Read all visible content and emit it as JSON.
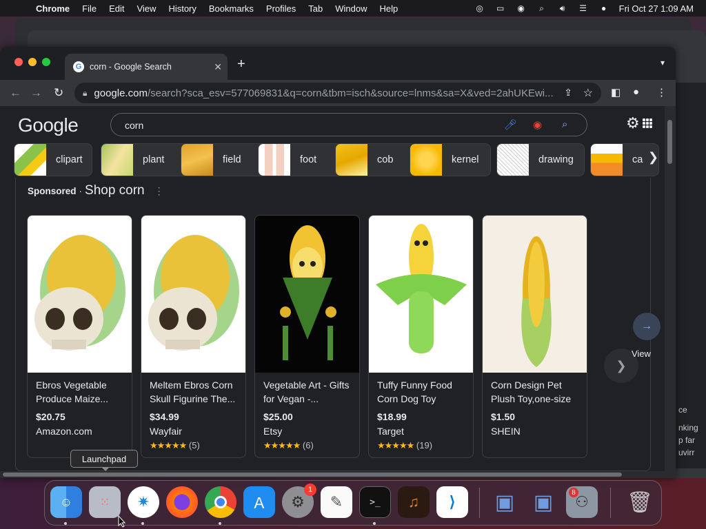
{
  "menubar": {
    "app_name": "Chrome",
    "menus": [
      "File",
      "Edit",
      "View",
      "History",
      "Bookmarks",
      "Profiles",
      "Tab",
      "Window",
      "Help"
    ],
    "datetime": "Fri Oct 27  1:09 AM"
  },
  "tab": {
    "title": "corn - Google Search"
  },
  "address": {
    "host": "google.com",
    "path": "/search?sca_esv=577069831&q=corn&tbm=isch&source=lnms&sa=X&ved=2ahUKEwi..."
  },
  "search": {
    "logo": "Google",
    "query": "corn"
  },
  "chips": [
    {
      "label": "clipart",
      "color": "#8bc34a"
    },
    {
      "label": "plant",
      "color": "#c5d86d"
    },
    {
      "label": "field",
      "color": "#e0a32a"
    },
    {
      "label": "foot",
      "color": "#f3d0c0"
    },
    {
      "label": "cob",
      "color": "#f0c419"
    },
    {
      "label": "kernel",
      "color": "#f6b800"
    },
    {
      "label": "drawing",
      "color": "#e6e6e6"
    },
    {
      "label": "ca",
      "color": "#f28c28"
    }
  ],
  "sponsored": {
    "label": "Sponsored",
    "separator": "·",
    "heading": "Shop corn"
  },
  "products": [
    {
      "title": "Ebros Vegetable Produce Maize...",
      "price": "$20.75",
      "seller": "Amazon.com",
      "stars": "",
      "reviews": ""
    },
    {
      "title": "Meltem Ebros Corn Skull Figurine The...",
      "price": "$34.99",
      "seller": "Wayfair",
      "stars": "★★★★★",
      "reviews": "(5)"
    },
    {
      "title": "Vegetable Art - Gifts for Vegan -...",
      "price": "$25.00",
      "seller": "Etsy",
      "stars": "★★★★★",
      "reviews": "(6)"
    },
    {
      "title": "Tuffy Funny Food Corn Dog Toy",
      "price": "$18.99",
      "seller": "Target",
      "stars": "★★★★★",
      "reviews": "(19)"
    },
    {
      "title": "Corn Design Pet Plush Toy,one-size",
      "price": "$1.50",
      "seller": "SHEIN",
      "stars": "",
      "reviews": ""
    }
  ],
  "view_more": "View",
  "background_window": {
    "lines": [
      "ce",
      "nking",
      "p far",
      "uvirr"
    ]
  },
  "tooltip": "Launchpad",
  "dock": {
    "settings_badge": "1",
    "steam_badge": "8"
  }
}
